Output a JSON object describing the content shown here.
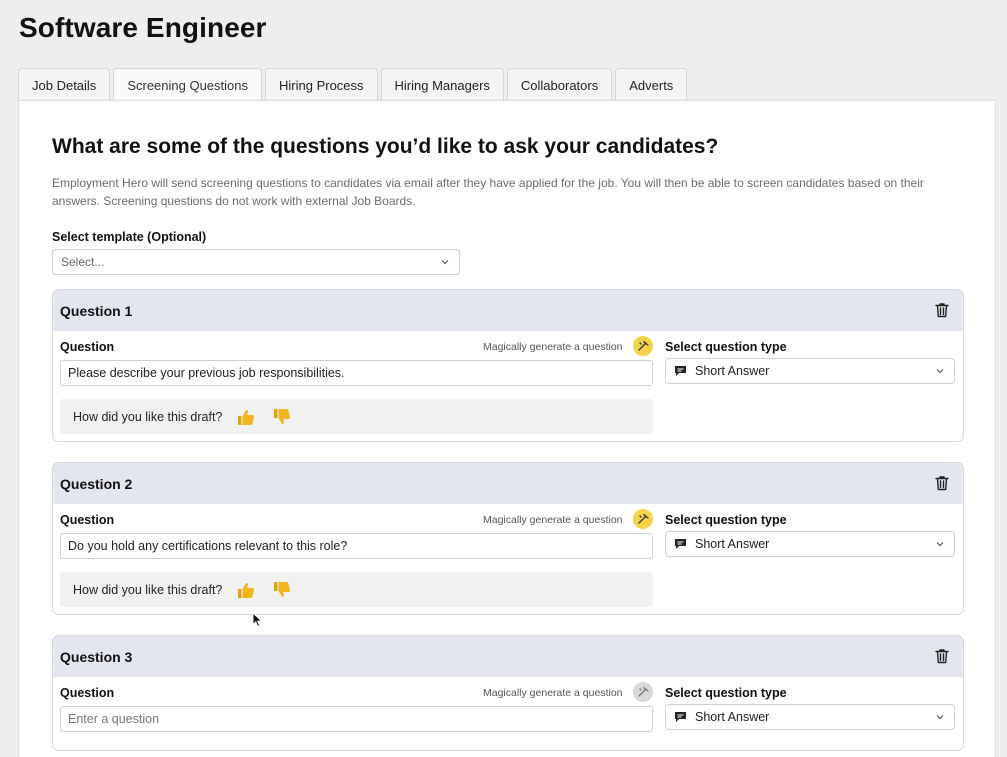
{
  "page": {
    "title": "Software Engineer"
  },
  "tabs": [
    {
      "label": "Job Details",
      "active": false
    },
    {
      "label": "Screening Questions",
      "active": true
    },
    {
      "label": "Hiring Process",
      "active": false
    },
    {
      "label": "Hiring Managers",
      "active": false
    },
    {
      "label": "Collaborators",
      "active": false
    },
    {
      "label": "Adverts",
      "active": false
    }
  ],
  "intro": {
    "heading": "What are some of the questions you’d like to ask your candidates?",
    "description": "Employment Hero will send screening questions to candidates via email after they have applied for the job. You will then be able to screen candidates based on their answers. Screening questions do not work with external Job Boards."
  },
  "template": {
    "label": "Select template (Optional)",
    "placeholder": "Select..."
  },
  "common": {
    "question_label": "Question",
    "magic_label": "Magically generate a question",
    "type_label": "Select question type",
    "feedback_prompt": "How did you like this draft?"
  },
  "questions": [
    {
      "title": "Question 1",
      "value": "Please describe your previous job responsibilities.",
      "type": "Short Answer"
    },
    {
      "title": "Question 2",
      "value": "Do you hold any certifications relevant to this role?",
      "type": "Short Answer"
    },
    {
      "title": "Question 3",
      "placeholder": "Enter a question",
      "type": "Short Answer"
    }
  ],
  "colors": {
    "magic_active": "#f4d24a",
    "magic_inactive": "#d9d9db",
    "card_header": "#e3e6ee",
    "thumb_emoji": "#f2b51e"
  },
  "icons": {
    "trash": "trash-icon",
    "magic": "magic-wand-icon",
    "message": "message-icon",
    "thumbs_up": "thumbs-up-icon",
    "thumbs_down": "thumbs-down-icon",
    "chevron": "chevron-down-icon"
  }
}
